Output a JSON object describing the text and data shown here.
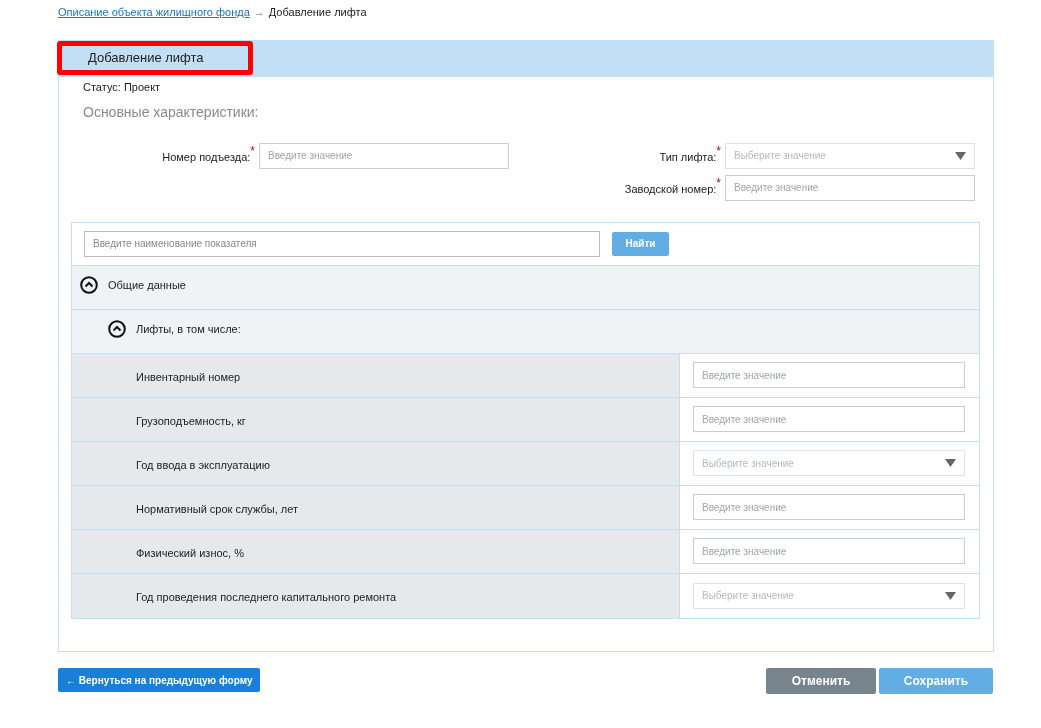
{
  "breadcrumb": {
    "link": "Описание объекта жилищного фонда",
    "separator": "→",
    "current": "Добавление лифта"
  },
  "panel": {
    "title": "Добавление лифта",
    "title_highlighted": true,
    "status": "Статус: Проект",
    "section": "Основные характеристики:"
  },
  "fields_left": [
    {
      "label": "Номер подъезда:",
      "required_mark": "*",
      "kind": "input",
      "placeholder": "Введите значение"
    }
  ],
  "fields_right": [
    {
      "label": "Тип лифта:",
      "required_mark": "*",
      "kind": "select",
      "placeholder": "Выберите значение"
    },
    {
      "label": "Заводской номер:",
      "required_mark": "*",
      "kind": "input",
      "placeholder": "Введите значение"
    }
  ],
  "search": {
    "placeholder": "Введите наименование показателя",
    "button": "Найти"
  },
  "groups": [
    {
      "label": "Общие данные",
      "expanded": true,
      "children": [
        {
          "label": "Лифты, в том числе:",
          "expanded": true,
          "rows": [
            {
              "label": "Инвентарный номер",
              "kind": "input",
              "placeholder": "Введите значение"
            },
            {
              "label": "Грузоподъемность, кг",
              "kind": "input",
              "placeholder": "Введите значение"
            },
            {
              "label": "Год ввода в эксплуатацию",
              "kind": "select",
              "placeholder": "Выберите значение"
            },
            {
              "label": "Нормативный срок службы, лет",
              "kind": "input",
              "placeholder": "Введите значение"
            },
            {
              "label": "Физический износ, %",
              "kind": "input",
              "placeholder": "Введите значение"
            },
            {
              "label": "Год проведения последнего капитального ремонта",
              "kind": "select",
              "placeholder": "Выберите значение"
            }
          ]
        }
      ]
    }
  ],
  "footer": {
    "back": "← Вернуться на предыдущую форму",
    "cancel": "Отменить",
    "save": "Сохранить"
  }
}
